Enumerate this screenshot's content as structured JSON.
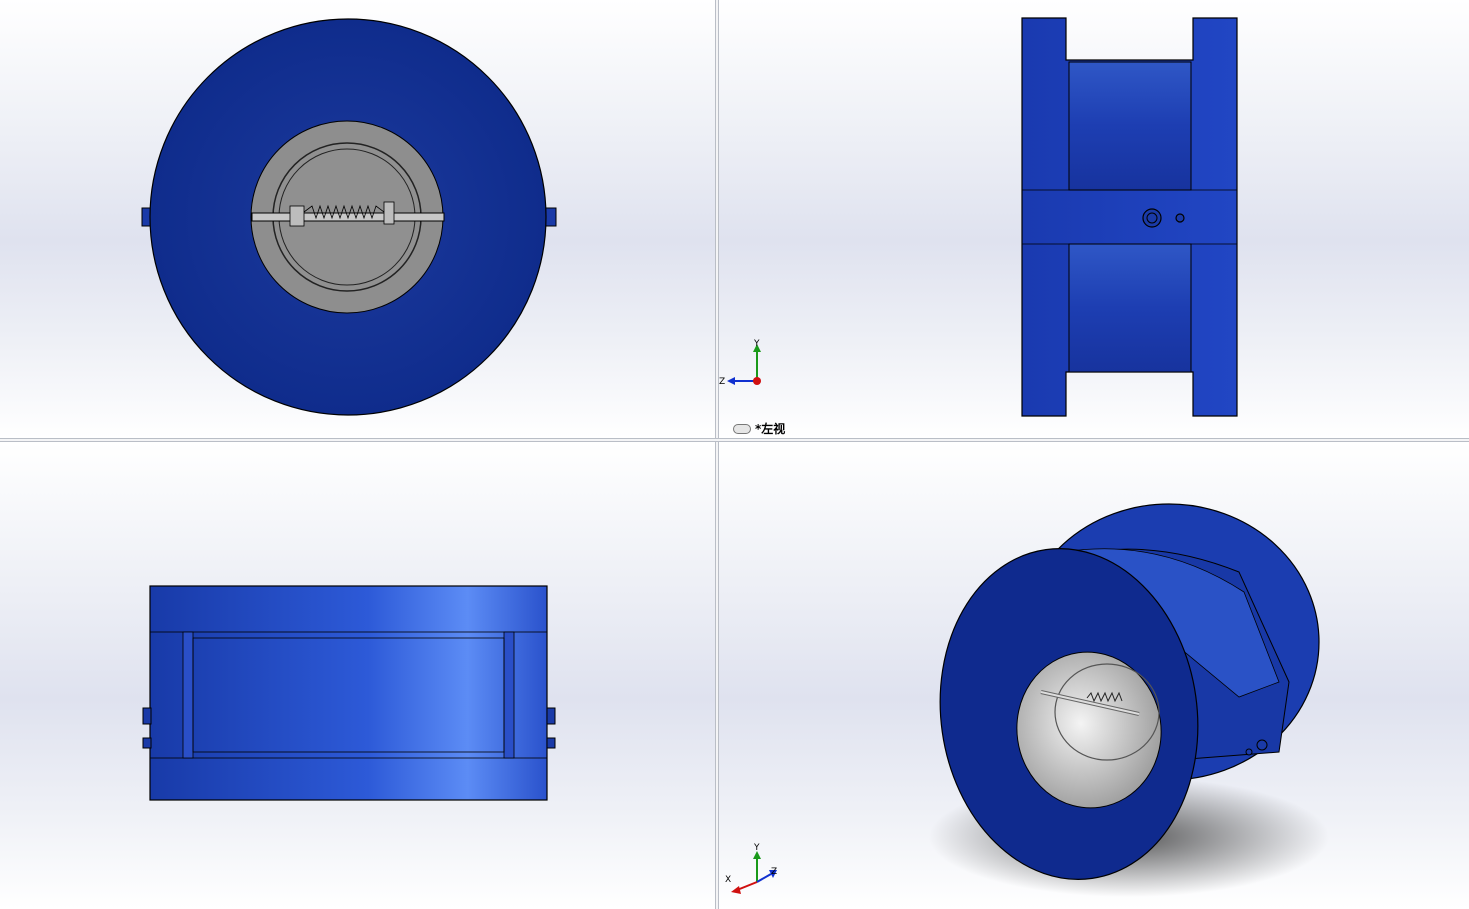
{
  "app": "SolidWorks",
  "viewports": [
    {
      "name": "front",
      "label": ""
    },
    {
      "name": "left",
      "label": "*左视"
    },
    {
      "name": "top",
      "label": ""
    },
    {
      "name": "isometric",
      "label": ""
    }
  ],
  "triad": {
    "x_label": "X",
    "y_label": "Y",
    "z_label": "Z"
  },
  "colors": {
    "body_blue": "#1f3fae",
    "body_dark": "#0c2a8a",
    "disc_gray": "#8c8c8c",
    "axis_red": "#d01010",
    "axis_green": "#1a9a1a",
    "axis_blue": "#1030d0"
  }
}
